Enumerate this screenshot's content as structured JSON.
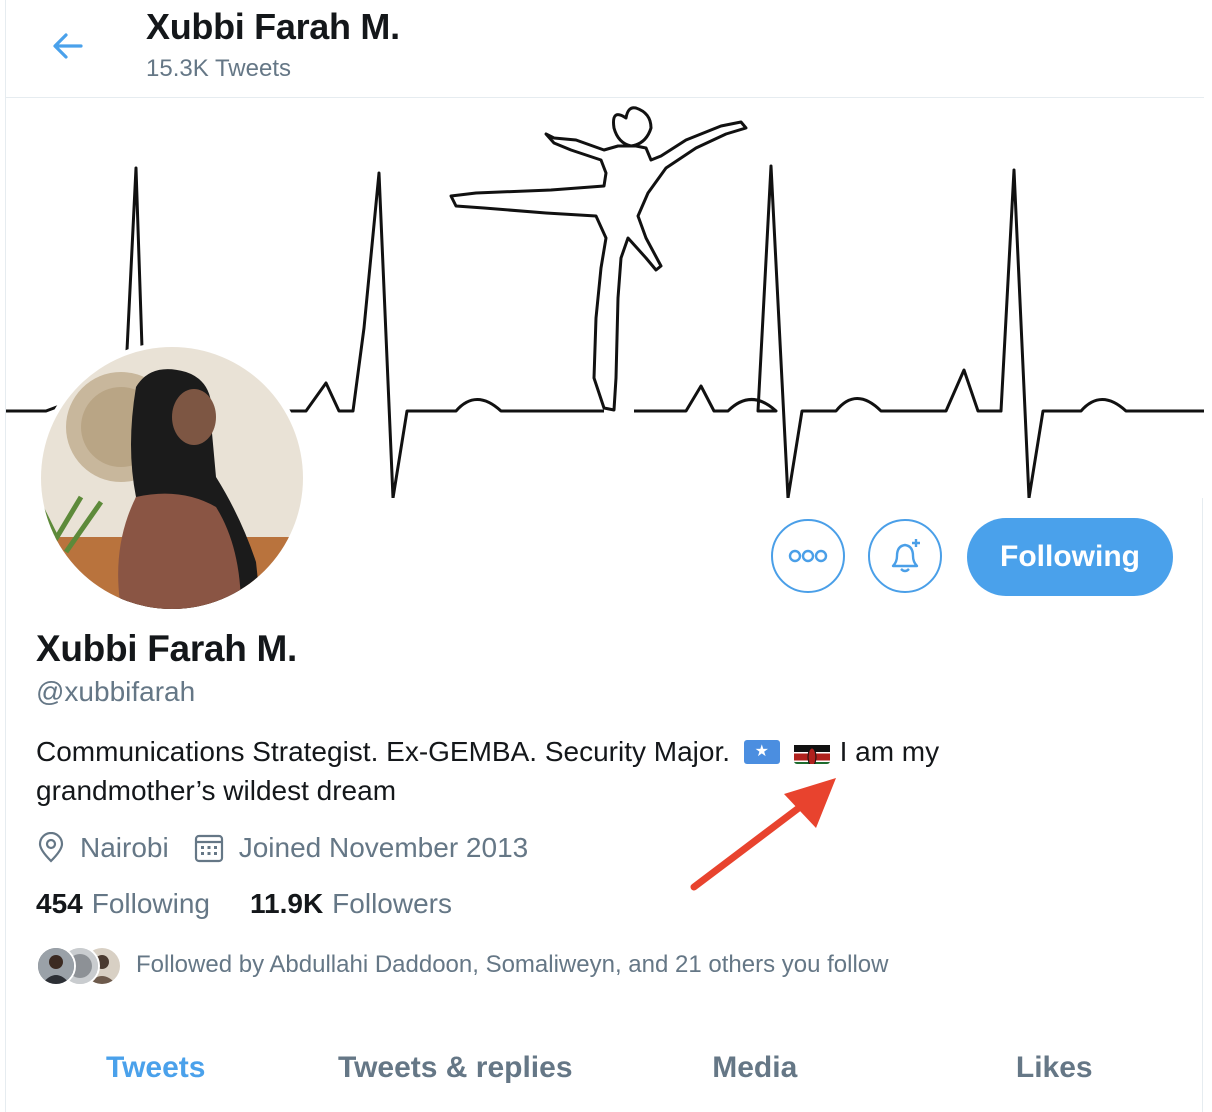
{
  "header": {
    "display_name": "Xubbi Farah M.",
    "tweet_count": "15.3K Tweets",
    "back_icon": "arrow-left-icon"
  },
  "profile": {
    "display_name": "Xubbi Farah M.",
    "handle": "@xubbifarah",
    "bio_before": "Communications Strategist. Ex-GEMBA. Security Major.",
    "bio_after": "I am my grandmother’s wildest dream",
    "flags": [
      "somalia-flag-icon",
      "kenya-flag-icon"
    ],
    "location": "Nairobi",
    "joined": "Joined November 2013"
  },
  "actions": {
    "more_icon": "more-dots-icon",
    "notify_icon": "bell-plus-icon",
    "following_label": "Following"
  },
  "stats": {
    "following_count": "454",
    "following_label": "Following",
    "followers_count": "11.9K",
    "followers_label": "Followers"
  },
  "followed_by": {
    "text": "Followed by Abdullahi Daddoon, Somaliweyn, and 21 others you follow"
  },
  "tabs": [
    {
      "label": "Tweets",
      "active": true
    },
    {
      "label": "Tweets & replies",
      "active": false
    },
    {
      "label": "Media",
      "active": false
    },
    {
      "label": "Likes",
      "active": false
    }
  ],
  "colors": {
    "accent": "#4aa1eb",
    "secondary_text": "#657786",
    "annotation_arrow": "#e8432e"
  }
}
